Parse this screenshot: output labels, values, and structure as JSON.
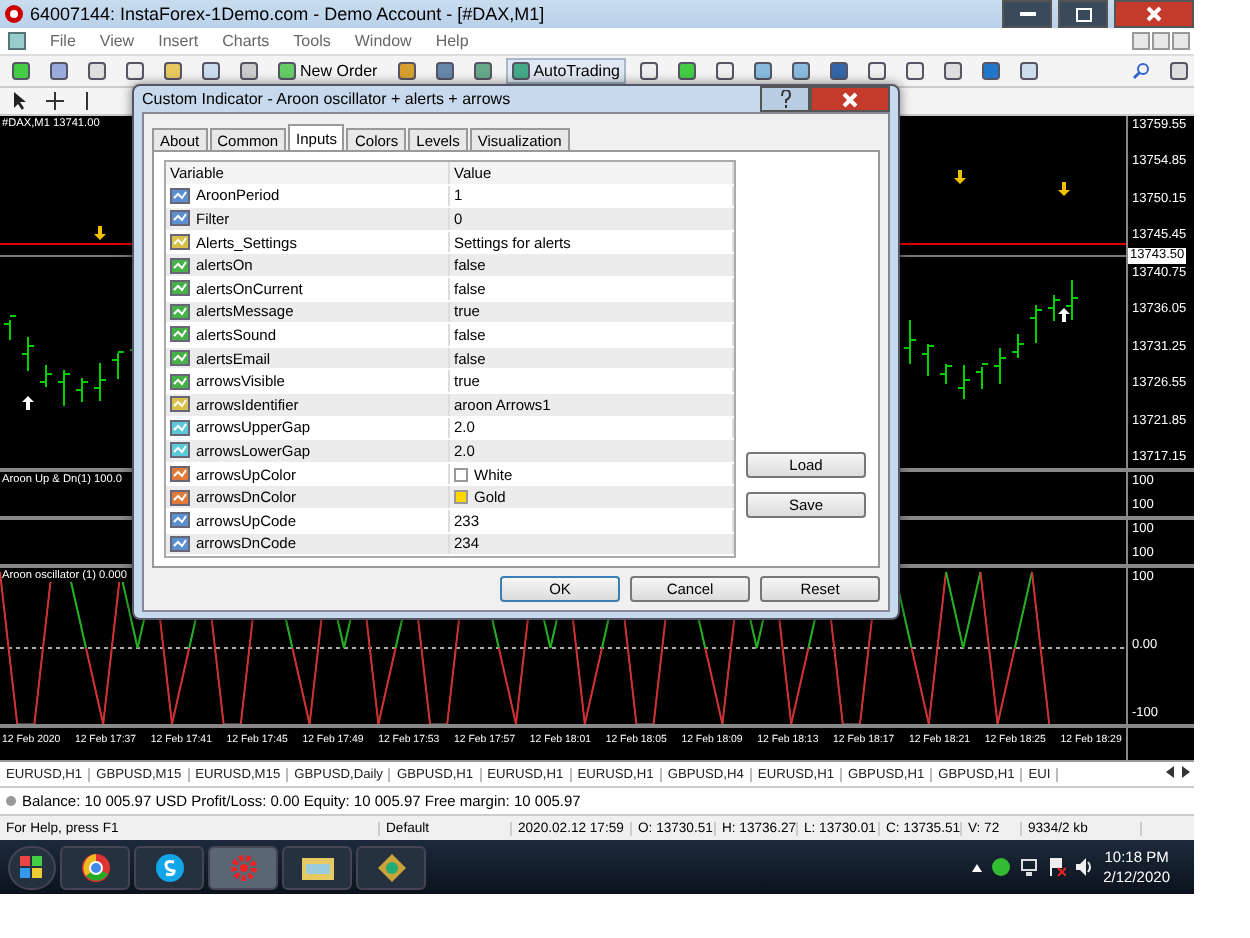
{
  "window": {
    "title": "64007144: InstaForex-1Demo.com - Demo Account - [#DAX,M1]"
  },
  "menu": [
    "File",
    "View",
    "Insert",
    "Charts",
    "Tools",
    "Window",
    "Help"
  ],
  "toolbar": {
    "new_order": "New Order",
    "autotrading": "AutoTrading"
  },
  "chart": {
    "symbol_label": "#DAX,M1  13741.00",
    "price_axis": [
      "13759.55",
      "13754.85",
      "13750.15",
      "13745.45",
      "13740.75",
      "13736.05",
      "13731.25",
      "13726.55",
      "13721.85",
      "13717.15"
    ],
    "current_price": "13743.50",
    "panes": [
      {
        "label": "Aroon Up & Dn(1) 100.0",
        "axis": [
          "100",
          "100"
        ]
      },
      {
        "axis": [
          "100",
          "100"
        ]
      },
      {
        "label": "Aroon oscillator (1) 0.000",
        "axis": [
          "100",
          "0.00",
          "-100"
        ]
      }
    ],
    "time_axis": [
      "12 Feb 2020",
      "12 Feb 17:37",
      "12 Feb 17:41",
      "12 Feb 17:45",
      "12 Feb 17:49",
      "12 Feb 17:53",
      "12 Feb 17:57",
      "12 Feb 18:01",
      "12 Feb 18:05",
      "12 Feb 18:09",
      "12 Feb 18:13",
      "12 Feb 18:17",
      "12 Feb 18:21",
      "12 Feb 18:25",
      "12 Feb 18:29"
    ]
  },
  "dialog": {
    "title": "Custom Indicator - Aroon oscillator + alerts + arrows",
    "tabs": [
      {
        "label": "About",
        "selected": false
      },
      {
        "label": "Common",
        "selected": false
      },
      {
        "label": "Inputs",
        "selected": true
      },
      {
        "label": "Colors",
        "selected": false
      },
      {
        "label": "Levels",
        "selected": false
      },
      {
        "label": "Visualization",
        "selected": false
      }
    ],
    "columns": [
      "Variable",
      "Value"
    ],
    "rows": [
      {
        "kind": "int",
        "variable": "AroonPeriod",
        "value": "1"
      },
      {
        "kind": "int",
        "variable": "Filter",
        "value": "0"
      },
      {
        "kind": "string",
        "variable": "Alerts_Settings",
        "value": "Settings for alerts"
      },
      {
        "kind": "bool",
        "variable": "alertsOn",
        "value": "false"
      },
      {
        "kind": "bool",
        "variable": "alertsOnCurrent",
        "value": "false"
      },
      {
        "kind": "bool",
        "variable": "alertsMessage",
        "value": "true"
      },
      {
        "kind": "bool",
        "variable": "alertsSound",
        "value": "false"
      },
      {
        "kind": "bool",
        "variable": "alertsEmail",
        "value": "false"
      },
      {
        "kind": "bool",
        "variable": "arrowsVisible",
        "value": "true"
      },
      {
        "kind": "string",
        "variable": "arrowsIdentifier",
        "value": "aroon Arrows1"
      },
      {
        "kind": "double",
        "variable": "arrowsUpperGap",
        "value": "2.0"
      },
      {
        "kind": "double",
        "variable": "arrowsLowerGap",
        "value": "2.0"
      },
      {
        "kind": "color",
        "variable": "arrowsUpColor",
        "value": "White",
        "color": "#ffffff"
      },
      {
        "kind": "color",
        "variable": "arrowsDnColor",
        "value": "Gold",
        "color": "#ffd700"
      },
      {
        "kind": "int",
        "variable": "arrowsUpCode",
        "value": "233"
      },
      {
        "kind": "int",
        "variable": "arrowsDnCode",
        "value": "234"
      }
    ],
    "side_buttons": [
      "Load",
      "Save"
    ],
    "buttons": [
      {
        "label": "OK",
        "default": true
      },
      {
        "label": "Cancel",
        "default": false
      },
      {
        "label": "Reset",
        "default": false
      }
    ]
  },
  "symbol_tabs": [
    "EURUSD,H1",
    "GBPUSD,M15",
    "EURUSD,M15",
    "GBPUSD,Daily",
    "GBPUSD,H1",
    "EURUSD,H1",
    "EURUSD,H1",
    "GBPUSD,H4",
    "EURUSD,H1",
    "GBPUSD,H1",
    "GBPUSD,H1",
    "EUI"
  ],
  "balance": "Balance: 10 005.97 USD  Profit/Loss: 0.00  Equity: 10 005.97  Free margin: 10 005.97",
  "status_bar": [
    "For Help, press F1",
    "Default",
    "2020.02.12 17:59",
    "O: 13730.51",
    "H: 13736.27",
    "L: 13730.01",
    "C: 13735.51",
    "V: 72",
    "9334/2 kb"
  ],
  "taskbar": {
    "time": "10:18 PM",
    "date": "2/12/2020"
  }
}
